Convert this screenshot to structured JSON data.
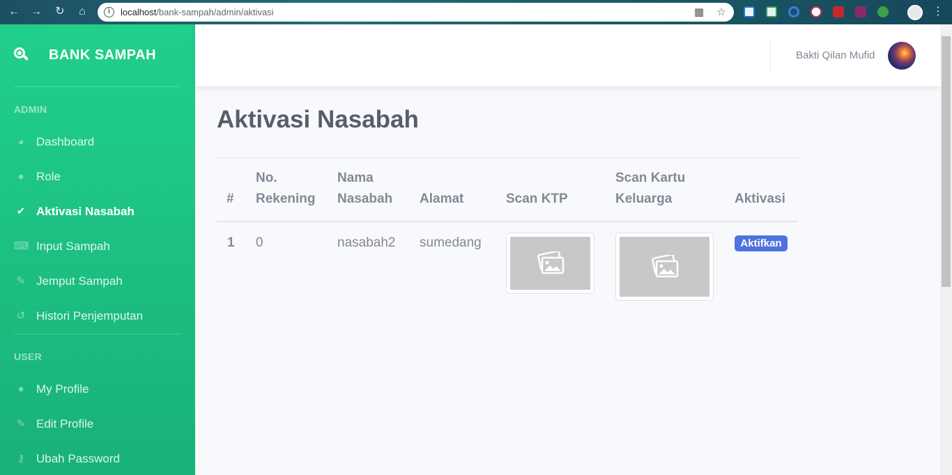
{
  "browser": {
    "url_host": "localhost",
    "url_path": "/bank-sampah/admin/aktivasi"
  },
  "sidebar": {
    "brand": "BANK SAMPAH",
    "admin_heading": "ADMIN",
    "admin_items": [
      {
        "label": "Dashboard",
        "icon": "tachometer-icon"
      },
      {
        "label": "Role",
        "icon": "user-icon"
      },
      {
        "label": "Aktivasi Nasabah",
        "icon": "user-check-icon",
        "active": true
      },
      {
        "label": "Input Sampah",
        "icon": "keyboard-icon"
      },
      {
        "label": "Jemput Sampah",
        "icon": "pen-icon"
      },
      {
        "label": "Histori Penjemputan",
        "icon": "history-icon"
      }
    ],
    "user_heading": "USER",
    "user_items": [
      {
        "label": "My Profile",
        "icon": "user-icon"
      },
      {
        "label": "Edit Profile",
        "icon": "user-edit-icon"
      },
      {
        "label": "Ubah Password",
        "icon": "key-icon"
      }
    ]
  },
  "topbar": {
    "user_name": "Bakti Qilan Mufid"
  },
  "main": {
    "title": "Aktivasi Nasabah",
    "table": {
      "headers": {
        "num": "#",
        "rekening_1": "No.",
        "rekening_2": "Rekening",
        "nama_1": "Nama",
        "nama_2": "Nasabah",
        "alamat": "Alamat",
        "ktp": "Scan KTP",
        "kk_1": "Scan Kartu",
        "kk_2": "Keluarga",
        "aktivasi": "Aktivasi"
      },
      "rows": [
        {
          "num": "1",
          "rekening": "0",
          "nama": "nasabah2",
          "alamat": "sumedang",
          "action": "Aktifkan"
        }
      ]
    }
  },
  "colors": {
    "sidebar_top": "#20d08a",
    "sidebar_bottom": "#19b179",
    "badge": "#4e73df",
    "text_muted": "#858796"
  }
}
